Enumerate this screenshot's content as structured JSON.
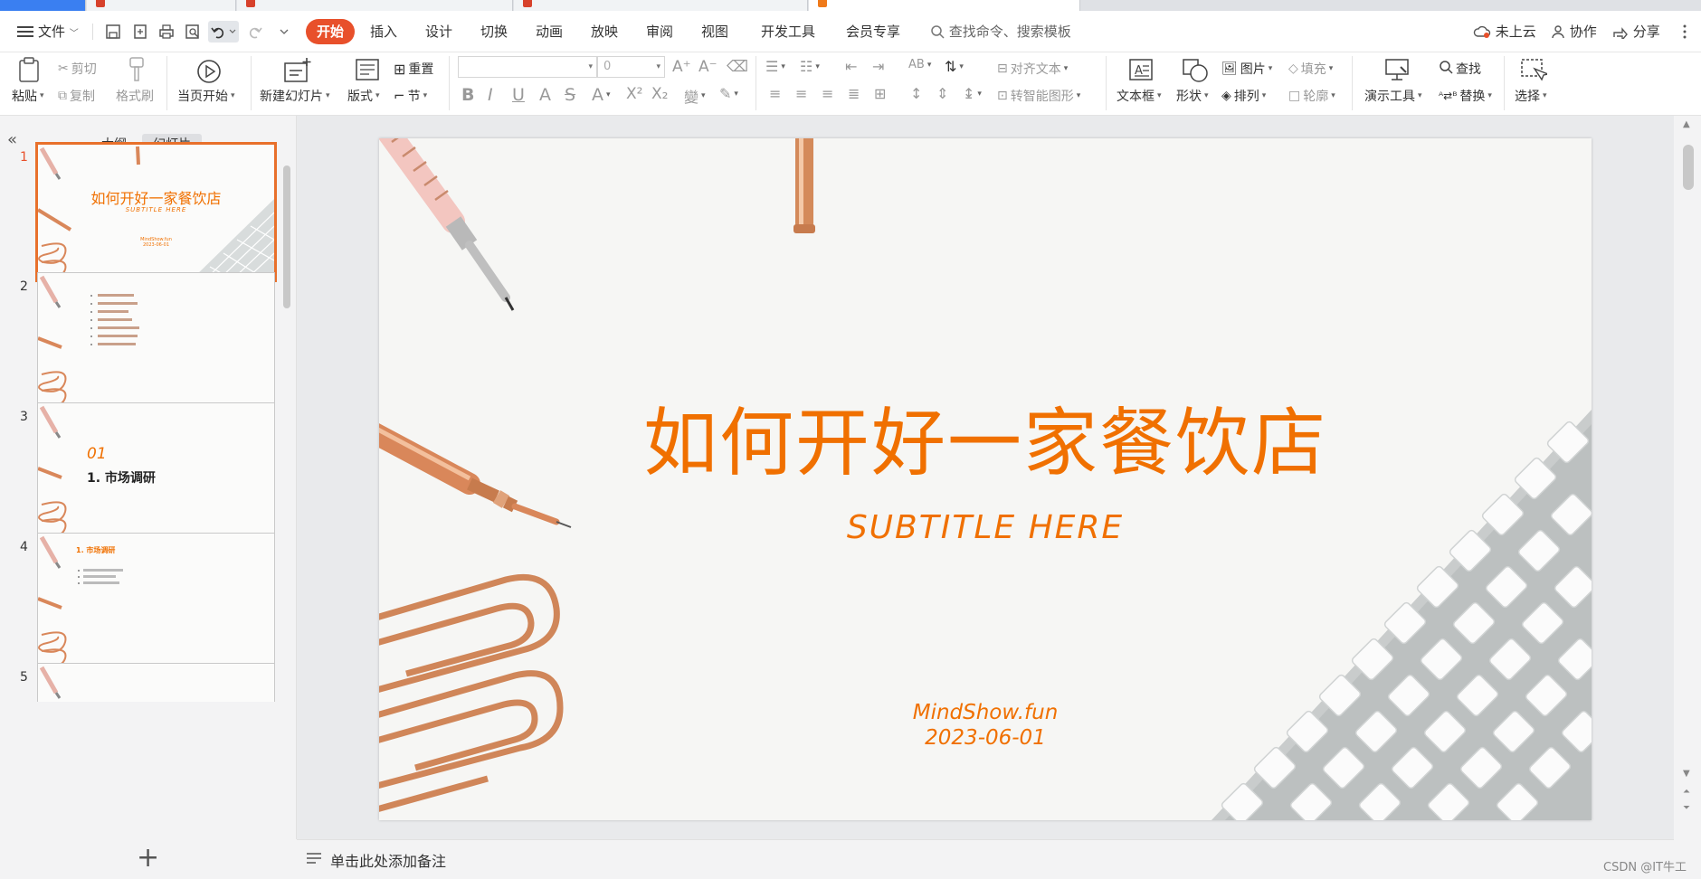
{
  "menu": {
    "file_label": "文件",
    "tabs": [
      "插入",
      "设计",
      "切换",
      "动画",
      "放映",
      "审阅",
      "视图",
      "开发工具",
      "会员专享"
    ],
    "active_tab": "开始",
    "search_placeholder": "查找命令、搜索模板",
    "cloud_label": "未上云",
    "collab_label": "协作",
    "share_label": "分享"
  },
  "ribbon": {
    "paste": "粘贴",
    "cut": "剪切",
    "copy": "复制",
    "format_painter": "格式刷",
    "start_from_current": "当页开始",
    "new_slide": "新建幻灯片",
    "layout": "版式",
    "reset": "重置",
    "section": "节",
    "font_size": "0",
    "align_text": "对齐文本",
    "smart_shape": "转智能图形",
    "text_box": "文本框",
    "shape": "形状",
    "picture": "图片",
    "arrange": "排列",
    "fill": "填充",
    "outline": "轮廓",
    "present_tools": "演示工具",
    "find": "查找",
    "replace": "替换",
    "select": "选择"
  },
  "left_panel": {
    "tab_outline": "大纲",
    "tab_slides": "幻灯片",
    "slide_numbers": [
      "1",
      "2",
      "3",
      "4",
      "5"
    ],
    "thumb1": {
      "title": "如何开好一家餐饮店",
      "subtitle": "SUBTITLE HERE",
      "site": "MindShow.fun",
      "date": "2023-06-01"
    },
    "thumb3": {
      "number": "01",
      "heading": "1. 市场调研"
    },
    "thumb4": {
      "heading": "1. 市场调研"
    }
  },
  "slide": {
    "title": "如何开好一家餐饮店",
    "subtitle": "SUBTITLE HERE",
    "site": "MindShow.fun",
    "date": "2023-06-01"
  },
  "notes_placeholder": "单击此处添加备注",
  "watermark": "CSDN @IT牛工",
  "colors": {
    "accent": "#e8502b",
    "slide_text": "#f07000",
    "copper": "#d9875a"
  }
}
